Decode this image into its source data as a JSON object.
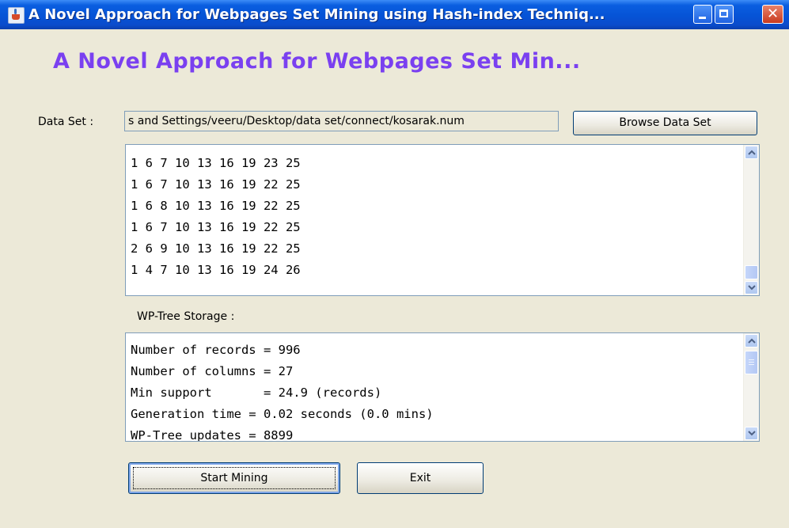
{
  "window": {
    "title": "A Novel Approach for Webpages Set Mining  using Hash-index Techniq...",
    "icon": "java-cup-icon",
    "controls": [
      "minimize-icon",
      "maximize-icon",
      "close-icon"
    ],
    "close_glyph": "✕"
  },
  "app_title": "A Novel Approach for Webpages Set Min...",
  "data_set": {
    "label": "Data Set :",
    "path_value": "s and Settings/veeru/Desktop/data set/connect/kosarak.num",
    "browse_label": "Browse Data Set"
  },
  "dataset_lines": [
    "1 6 7 10 13 16 19 23 25",
    "1 6 7 10 13 16 19 22 25",
    "1 6 8 10 13 16 19 22 25",
    "1 6 7 10 13 16 19 22 25",
    "2 6 9 10 13 16 19 22 25",
    "1 4 7 10 13 16 19 24 26"
  ],
  "wp_tree": {
    "label": "WP-Tree Storage :",
    "lines": [
      "Number of records = 996",
      "Number of columns = 27",
      "Min support       = 24.9 (records)",
      "Generation time = 0.02 seconds (0.0 mins)",
      "WP-Tree updates = 8899"
    ]
  },
  "buttons": {
    "start": "Start Mining",
    "exit": "Exit"
  },
  "colors": {
    "title_accent": "#7a40f0",
    "window_bg": "#ece9d8",
    "titlebar": "#0653d6"
  }
}
